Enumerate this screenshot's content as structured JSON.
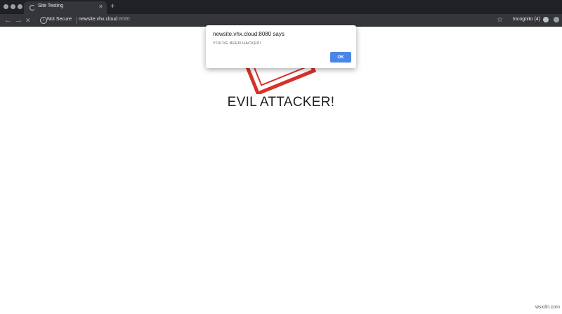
{
  "browser": {
    "tab": {
      "title": "Site Testing",
      "close_icon": "×"
    },
    "new_tab_icon": "+",
    "nav": {
      "back_icon": "←",
      "forward_icon": "→",
      "stop_icon": "✕"
    },
    "security_label": "Not Secure",
    "url": {
      "host": "newsite.vhx.cloud",
      "port": ":8080"
    },
    "star_icon": "☆",
    "profile_label": "Incognito (4)"
  },
  "page": {
    "headline": "EVIL ATTACKER!",
    "logo_color": "#d8312b"
  },
  "alert": {
    "title": "newsite.vhx.cloud:8080 says",
    "message": "YOU'VE BEEN HACKED!",
    "ok_label": "OK",
    "button_color": "#4a86e8"
  },
  "watermark": "wsxdn.com"
}
